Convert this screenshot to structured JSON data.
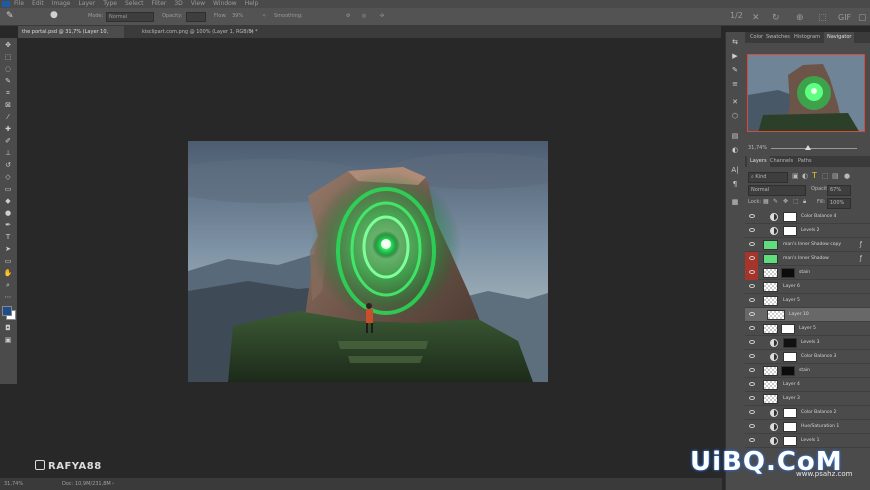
{
  "menubar": {
    "items": [
      "File",
      "Edit",
      "Image",
      "Layer",
      "Type",
      "Select",
      "Filter",
      "3D",
      "View",
      "Window",
      "Help"
    ]
  },
  "options": {
    "mode_label": "Mode:",
    "mode_value": "Normal",
    "opacity_label": "Opacity:",
    "flow_label": "Flow:",
    "flow_value": "39%",
    "smoothing_label": "Smoothing:",
    "page_indicator": "1/2"
  },
  "tabs": [
    {
      "label": "the portal.psd @ 31,7% (Layer 10, RGB/8#) *",
      "close": "×"
    },
    {
      "label": "kisclipart.com.png @ 100% (Layer 1, RGB/8) *",
      "close": "×"
    }
  ],
  "status": {
    "zoom": "31,74%",
    "doc": "Doc: 10,9M/231,8M"
  },
  "watermark_left": "RAFYA88",
  "panel": {
    "top_tabs": [
      "Color",
      "Swatches",
      "Histogram",
      "Navigator"
    ],
    "active_top_tab": "Navigator",
    "nav_zoom": "31,74%",
    "layer_tabs": [
      "Layers",
      "Channels",
      "Paths"
    ],
    "active_layer_tab": "Layers",
    "filter_kind": "Kind",
    "blend_mode": "Normal",
    "opacity_value": "67%",
    "lock_label": "Lock:",
    "fill_label": "Fill:",
    "fill_value": "100%"
  },
  "layers": [
    {
      "name": "Color Balance 4",
      "type": "adjustment"
    },
    {
      "name": "Levels 2",
      "type": "adjustment"
    },
    {
      "name": "man's Inner Shadow copy",
      "type": "green",
      "fx": true
    },
    {
      "name": "man's Inner Shadow",
      "type": "green",
      "fx": true,
      "red": true
    },
    {
      "name": "stain",
      "type": "mask-dark",
      "red": true
    },
    {
      "name": "Layer 6",
      "type": "pixel"
    },
    {
      "name": "Layer 5",
      "type": "pixel"
    },
    {
      "name": "Layer 10",
      "type": "pixel",
      "selected": true
    },
    {
      "name": "Layer 5",
      "type": "pixel-mask"
    },
    {
      "name": "Levels 3",
      "type": "adjustment-dark"
    },
    {
      "name": "Color Balance 3",
      "type": "adjustment"
    },
    {
      "name": "stain",
      "type": "mask-dark"
    },
    {
      "name": "Layer 4",
      "type": "pixel"
    },
    {
      "name": "Layer 3",
      "type": "pixel"
    },
    {
      "name": "Color Balance 2",
      "type": "adjustment"
    },
    {
      "name": "Hue/Saturation 1",
      "type": "adjustment"
    },
    {
      "name": "Levels 1",
      "type": "adjustment"
    }
  ],
  "watermark_right": "UiBQ.CoM",
  "watermark_sub": "www.psahz.com",
  "colors": {
    "accent_red": "#d94a3a",
    "portal_green": "#2bff6a",
    "selected_layer": "#686868"
  }
}
